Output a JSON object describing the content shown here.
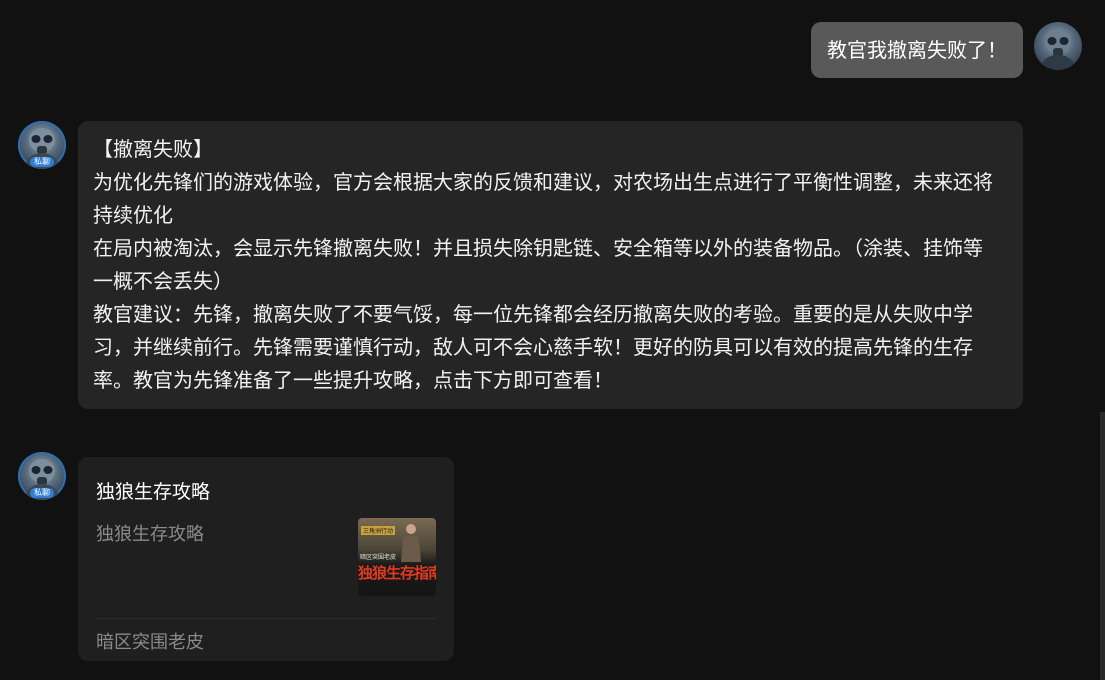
{
  "messages": {
    "user": {
      "text": "教官我撤离失败了！"
    },
    "bot": {
      "badge": "私聊",
      "lines": [
        "【撤离失败】",
        "为优化先锋们的游戏体验，官方会根据大家的反馈和建议，对农场出生点进行了平衡性调整，未来还将持续优化",
        "在局内被淘汰，会显示先锋撤离失败！并且损失除钥匙链、安全箱等以外的装备物品。（涂装、挂饰等一概不会丢失）",
        "教官建议：先锋，撤离失败了不要气馁，每一位先锋都会经历撤离失败的考验。重要的是从失败中学习，并继续前行。先锋需要谨慎行动，敌人可不会心慈手软！更好的防具可以有效的提高先锋的生存率。教官为先锋准备了一些提升攻略，点击下方即可查看！"
      ]
    },
    "card": {
      "badge": "私聊",
      "title": "独狼生存攻略",
      "description": "独狼生存攻略",
      "thumbnail": {
        "tag": "三角洲行动",
        "subtitle": "暗区突围老皮",
        "main_text": "独狼生存指南"
      },
      "footer": "暗区突围老皮"
    }
  },
  "colors": {
    "background": "#111111",
    "user_bubble": "#595959",
    "bot_bubble": "#252525",
    "card": "#1f1f1f",
    "badge": "#2e7fd3",
    "thumb_title": "#e23b20"
  },
  "icons": {
    "user_avatar": "gasmask-soldier-avatar",
    "bot_avatar": "gasmask-soldier-avatar"
  }
}
